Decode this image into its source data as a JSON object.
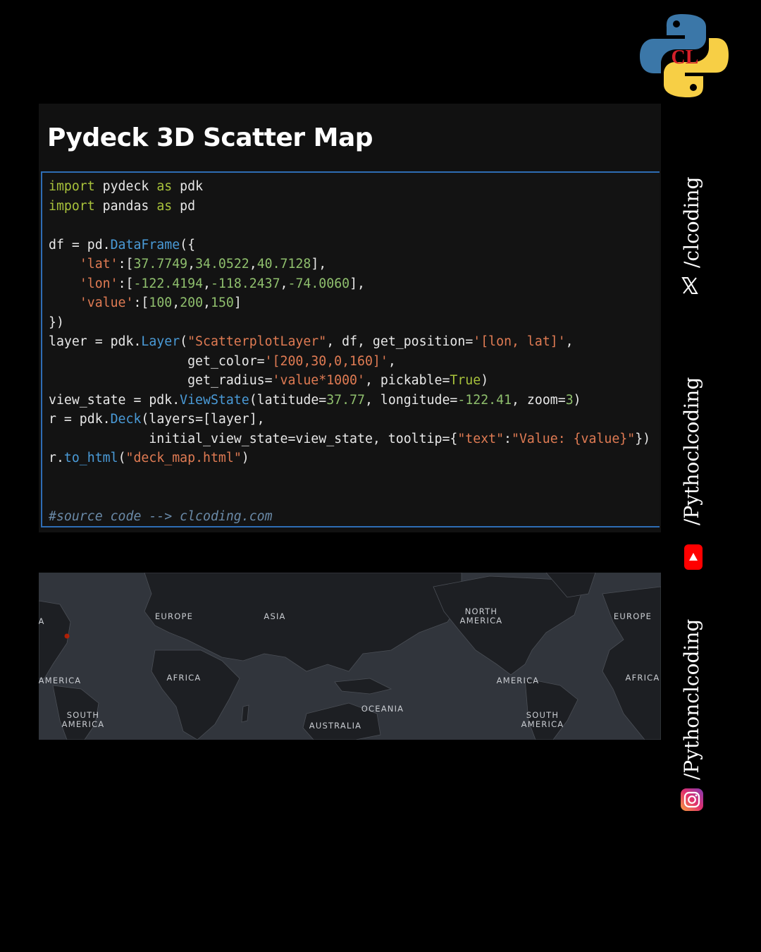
{
  "page": {
    "title": "Pydeck 3D Scatter Map"
  },
  "code": {
    "lines": [
      [
        {
          "t": "import",
          "c": "kw"
        },
        {
          "t": " pydeck "
        },
        {
          "t": "as",
          "c": "kw"
        },
        {
          "t": " pdk"
        }
      ],
      [
        {
          "t": "import",
          "c": "kw"
        },
        {
          "t": " pandas "
        },
        {
          "t": "as",
          "c": "kw"
        },
        {
          "t": " pd"
        }
      ],
      [],
      [
        {
          "t": "df = pd."
        },
        {
          "t": "DataFrame",
          "c": "fn"
        },
        {
          "t": "({"
        }
      ],
      [
        {
          "t": "    "
        },
        {
          "t": "'lat'",
          "c": "str"
        },
        {
          "t": ":["
        },
        {
          "t": "37.7749",
          "c": "num"
        },
        {
          "t": ","
        },
        {
          "t": "34.0522",
          "c": "num"
        },
        {
          "t": ","
        },
        {
          "t": "40.7128",
          "c": "num"
        },
        {
          "t": "],"
        }
      ],
      [
        {
          "t": "    "
        },
        {
          "t": "'lon'",
          "c": "str"
        },
        {
          "t": ":["
        },
        {
          "t": "-122.4194",
          "c": "num"
        },
        {
          "t": ","
        },
        {
          "t": "-118.2437",
          "c": "num"
        },
        {
          "t": ","
        },
        {
          "t": "-74.0060",
          "c": "num"
        },
        {
          "t": "],"
        }
      ],
      [
        {
          "t": "    "
        },
        {
          "t": "'value'",
          "c": "str"
        },
        {
          "t": ":["
        },
        {
          "t": "100",
          "c": "num"
        },
        {
          "t": ","
        },
        {
          "t": "200",
          "c": "num"
        },
        {
          "t": ","
        },
        {
          "t": "150",
          "c": "num"
        },
        {
          "t": "]"
        }
      ],
      [
        {
          "t": "})"
        }
      ],
      [
        {
          "t": "layer = pdk."
        },
        {
          "t": "Layer",
          "c": "fn"
        },
        {
          "t": "("
        },
        {
          "t": "\"ScatterplotLayer\"",
          "c": "str"
        },
        {
          "t": ", df, get_position="
        },
        {
          "t": "'[lon, lat]'",
          "c": "str"
        },
        {
          "t": ","
        }
      ],
      [
        {
          "t": "                  get_color="
        },
        {
          "t": "'[200,30,0,160]'",
          "c": "str"
        },
        {
          "t": ","
        }
      ],
      [
        {
          "t": "                  get_radius="
        },
        {
          "t": "'value*1000'",
          "c": "str"
        },
        {
          "t": ", pickable="
        },
        {
          "t": "True",
          "c": "kw"
        },
        {
          "t": ")"
        }
      ],
      [
        {
          "t": "view_state = pdk."
        },
        {
          "t": "ViewState",
          "c": "fn"
        },
        {
          "t": "(latitude="
        },
        {
          "t": "37.77",
          "c": "num"
        },
        {
          "t": ", longitude="
        },
        {
          "t": "-122.41",
          "c": "num"
        },
        {
          "t": ", zoom="
        },
        {
          "t": "3",
          "c": "num"
        },
        {
          "t": ")"
        }
      ],
      [
        {
          "t": "r = pdk."
        },
        {
          "t": "Deck",
          "c": "fn"
        },
        {
          "t": "(layers=[layer],"
        }
      ],
      [
        {
          "t": "             initial_view_state=view_state, tooltip={"
        },
        {
          "t": "\"text\"",
          "c": "str"
        },
        {
          "t": ":"
        },
        {
          "t": "\"Value: {value}\"",
          "c": "str"
        },
        {
          "t": "})"
        }
      ],
      [
        {
          "t": "r."
        },
        {
          "t": "to_html",
          "c": "fn"
        },
        {
          "t": "("
        },
        {
          "t": "\"deck_map.html\"",
          "c": "str"
        },
        {
          "t": ")"
        }
      ],
      [],
      [],
      [
        {
          "t": "#source code --> clcoding.com",
          "c": "comment"
        }
      ]
    ]
  },
  "map": {
    "labels": [
      {
        "text": "EUROPE"
      },
      {
        "text": "ASIA"
      },
      {
        "text": "NORTH\nAMERICA"
      },
      {
        "text": "EUROPE"
      },
      {
        "text": "A"
      },
      {
        "text": "AMERICA"
      },
      {
        "text": "AFRICA"
      },
      {
        "text": "AMERICA"
      },
      {
        "text": "AFRICA"
      },
      {
        "text": "SOUTH\nAMERICA"
      },
      {
        "text": "OCEANIA"
      },
      {
        "text": "AUSTRALIA"
      },
      {
        "text": "SOUTH\nAMERICA"
      }
    ]
  },
  "sidebar": {
    "x_handle": "/clcoding",
    "youtube_handle": "/Pythoclcoding",
    "instagram_handle": "/Pythonclcoding"
  },
  "logo": {
    "text": "CL"
  },
  "colors": {
    "background": "#000000",
    "code_border": "#2e6db4",
    "keyword": "#a8c23b",
    "function": "#4a9bd8",
    "string": "#e07b53",
    "number": "#8fbf6d",
    "map_water": "#31353c",
    "map_land": "#1d1f23",
    "youtube_red": "#ff0000"
  }
}
